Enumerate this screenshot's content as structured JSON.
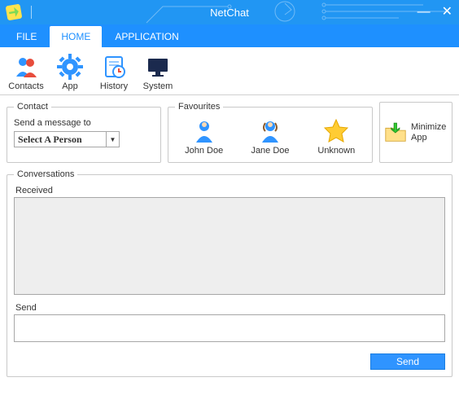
{
  "window": {
    "title": "NetChat"
  },
  "tabs": {
    "file": "FILE",
    "home": "HOME",
    "application": "APPLICATION"
  },
  "ribbon": {
    "contacts": "Contacts",
    "app": "App",
    "history": "History",
    "system": "System"
  },
  "contact": {
    "legend": "Contact",
    "hint": "Send a message to",
    "selected": "Select A Person"
  },
  "favourites": {
    "legend": "Favourites",
    "items": [
      {
        "label": "John Doe"
      },
      {
        "label": "Jane Doe"
      },
      {
        "label": "Unknown"
      }
    ]
  },
  "minimize": {
    "line1": "Minimize",
    "line2": "App"
  },
  "conversations": {
    "legend": "Conversations",
    "received_label": "Received",
    "received_text": "",
    "send_label": "Send",
    "send_text": "",
    "send_button": "Send"
  },
  "colors": {
    "accent": "#1e90ff"
  }
}
